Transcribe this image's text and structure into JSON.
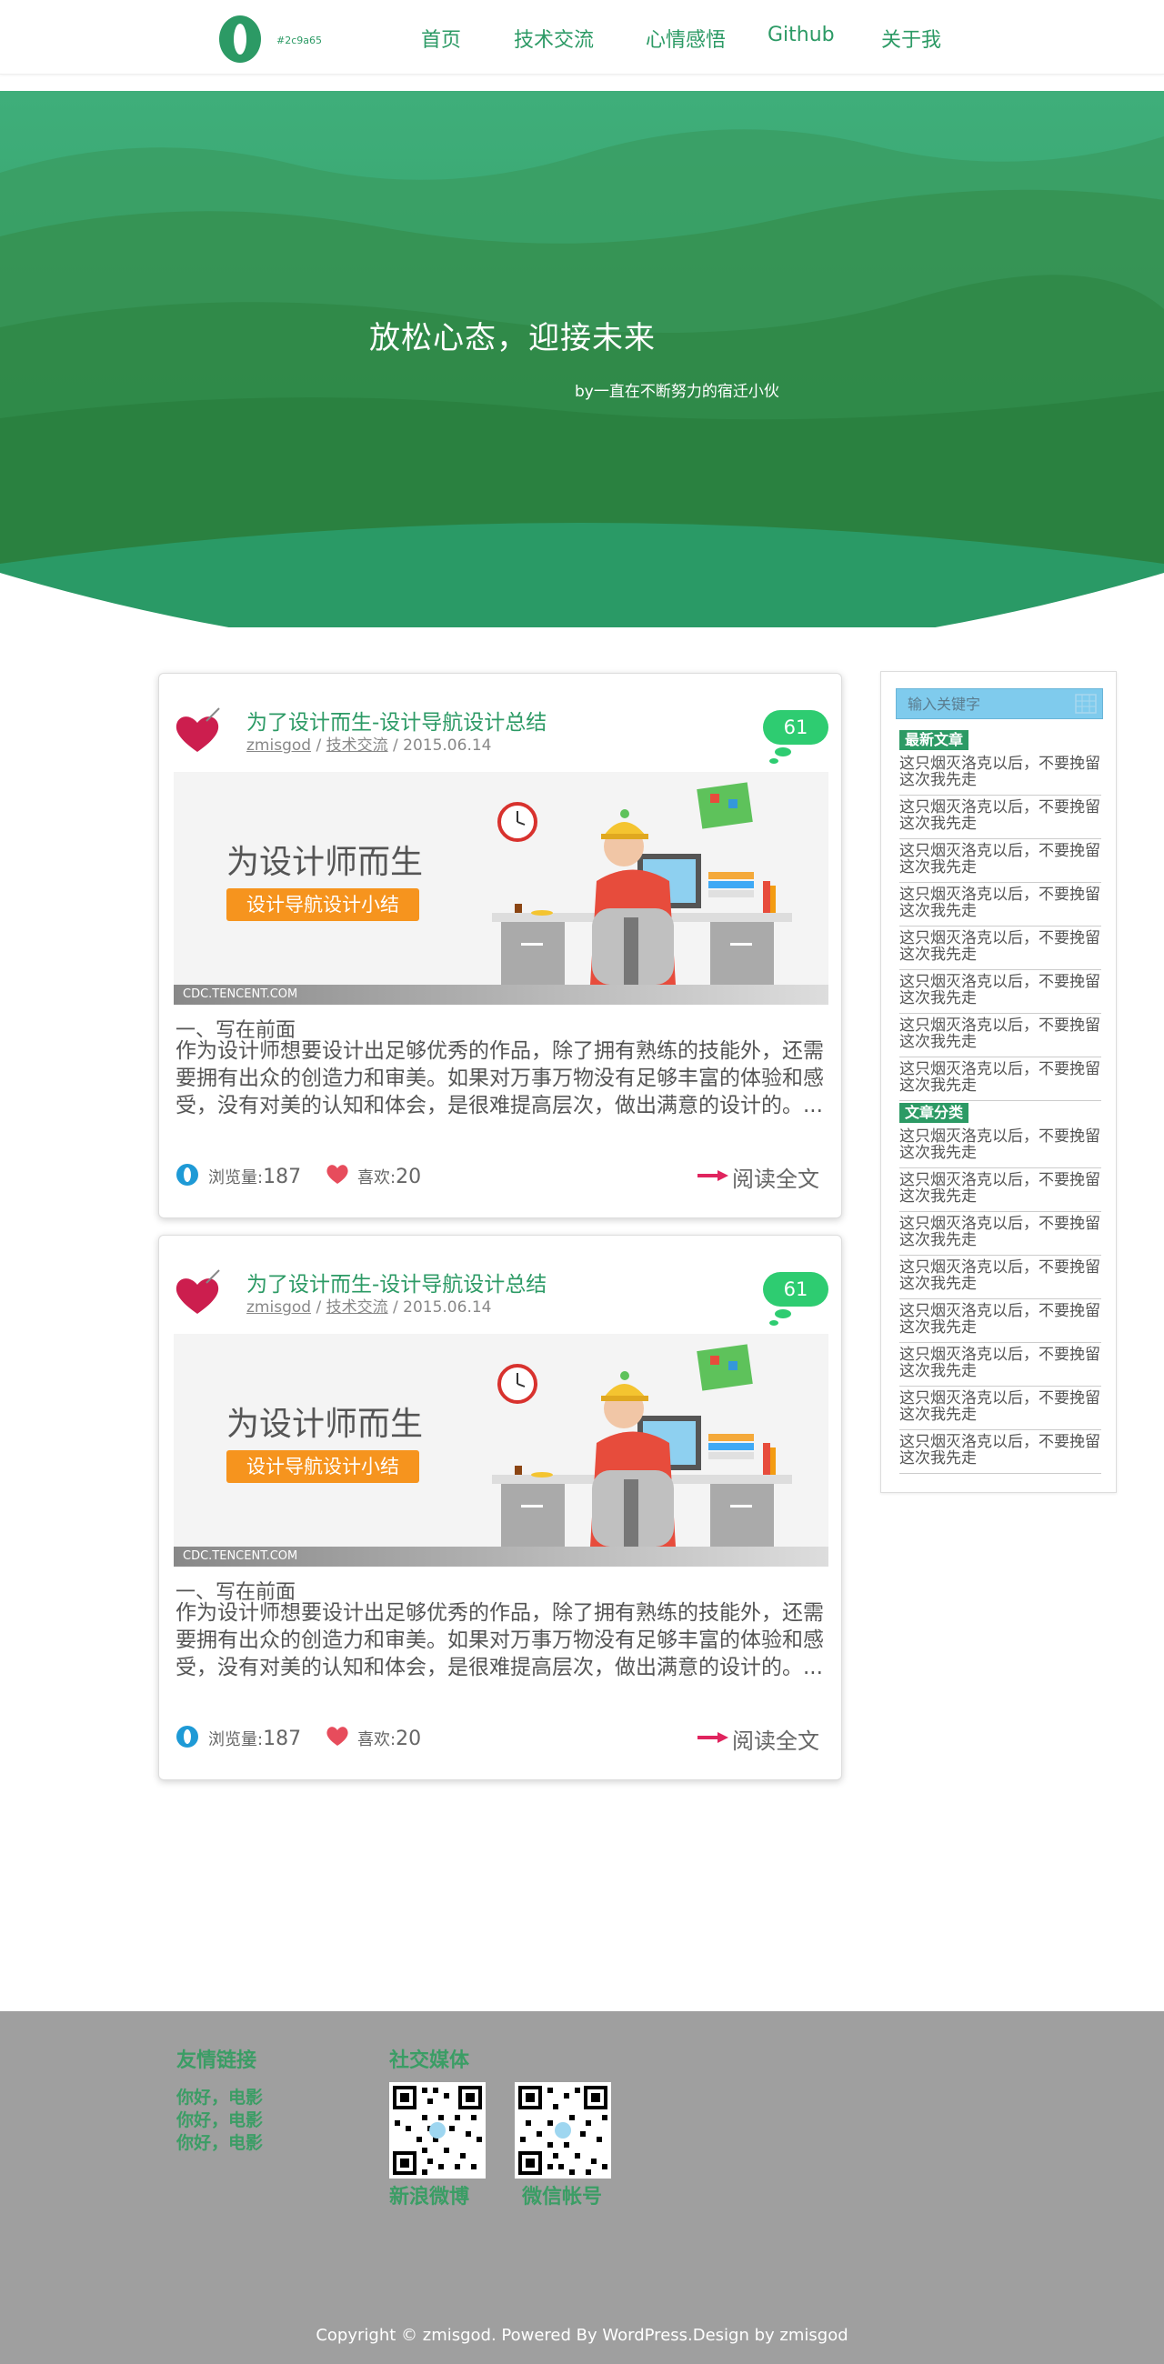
{
  "header": {
    "logo_text": "#2c9a65",
    "nav": [
      "首页",
      "技术交流",
      "心情感悟",
      "Github",
      "关于我"
    ],
    "accent_color": "#2c9a65"
  },
  "hero": {
    "title": "放松心态，迎接未来",
    "subtitle": "by一直在不断努力的宿迁小伙"
  },
  "posts": [
    {
      "title": "为了设计而生-设计导航设计总结",
      "author": "zmisgod",
      "category": "技术交流",
      "date": "2015.06.14",
      "comments": "61",
      "banner_title": "为设计师而生",
      "banner_button": "设计导航设计小结",
      "banner_source": "CDC.TENCENT.COM",
      "heading": "一、写在前面",
      "excerpt": "作为设计师想要设计出足够优秀的作品，除了拥有熟练的技能外，还需要拥有出众的创造力和审美。如果对万事万物没有足够丰富的体验和感受，没有对美的认知和体会，是很难提高层次，做出满意的设计的。...",
      "views_label": "浏览量:",
      "views": "187",
      "likes_label": "喜欢:",
      "likes": "20",
      "read_more": "阅读全文"
    },
    {
      "title": "为了设计而生-设计导航设计总结",
      "author": "zmisgod",
      "category": "技术交流",
      "date": "2015.06.14",
      "comments": "61",
      "banner_title": "为设计师而生",
      "banner_button": "设计导航设计小结",
      "banner_source": "CDC.TENCENT.COM",
      "heading": "一、写在前面",
      "excerpt": "作为设计师想要设计出足够优秀的作品，除了拥有熟练的技能外，还需要拥有出众的创造力和审美。如果对万事万物没有足够丰富的体验和感受，没有对美的认知和体会，是很难提高层次，做出满意的设计的。...",
      "views_label": "浏览量:",
      "views": "187",
      "likes_label": "喜欢:",
      "likes": "20",
      "read_more": "阅读全文"
    }
  ],
  "sidebar": {
    "search_placeholder": "输入关键字",
    "latest_title": "最新文章",
    "latest": [
      "这只烟灭洛克以后，不要挽留这次我先走",
      "这只烟灭洛克以后，不要挽留这次我先走",
      "这只烟灭洛克以后，不要挽留这次我先走",
      "这只烟灭洛克以后，不要挽留这次我先走",
      "这只烟灭洛克以后，不要挽留这次我先走",
      "这只烟灭洛克以后，不要挽留这次我先走",
      "这只烟灭洛克以后，不要挽留这次我先走",
      "这只烟灭洛克以后，不要挽留这次我先走"
    ],
    "category_title": "文章分类",
    "categories": [
      "这只烟灭洛克以后，不要挽留这次我先走",
      "这只烟灭洛克以后，不要挽留这次我先走",
      "这只烟灭洛克以后，不要挽留这次我先走",
      "这只烟灭洛克以后，不要挽留这次我先走",
      "这只烟灭洛克以后，不要挽留这次我先走",
      "这只烟灭洛克以后，不要挽留这次我先走",
      "这只烟灭洛克以后，不要挽留这次我先走",
      "这只烟灭洛克以后，不要挽留这次我先走"
    ]
  },
  "footer": {
    "links_title": "友情链接",
    "links": [
      "你好，电影",
      "你好，电影",
      "你好，电影"
    ],
    "social_title": "社交媒体",
    "weibo_label": "新浪微博",
    "wechat_label": "微信帐号",
    "copyright": "Copyright © zmisgod. Powered By WordPress.Design by zmisgod"
  }
}
